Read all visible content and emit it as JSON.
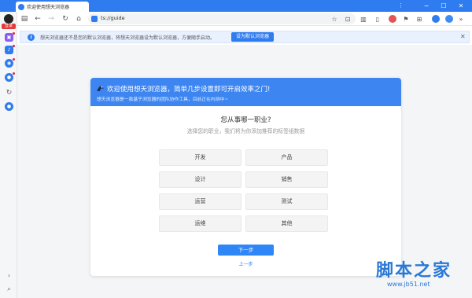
{
  "tab": {
    "title": "欢迎使用想天浏览器"
  },
  "window": {
    "min": "−",
    "max": "☐",
    "close": "✕",
    "menu": "⋮"
  },
  "sidebar": {
    "login_label": "登录"
  },
  "address_bar": {
    "url": "ts://guide"
  },
  "notice": {
    "info": "i",
    "text": "想天浏览器还不是您的默认浏览器，将想天浏览器设为默认浏览器，方便随手启动。",
    "button": "设为默认浏览器",
    "close": "✕"
  },
  "card": {
    "headline": "欢迎使用想天浏览器，简单几步设置即可开启效率之门!",
    "subline": "想天浏览器是一款基于浏览器的团队协作工具，目前正在内测中~",
    "question": "您从事哪一职业?",
    "hint": "选择您的职业，我们将为你添加推荐的标签组数据",
    "options": [
      "开发",
      "产品",
      "设计",
      "销售",
      "运营",
      "测试",
      "运维",
      "其他"
    ],
    "next": "下一步",
    "prev": "上一步"
  },
  "watermark": {
    "text": "脚本之家",
    "url": "www.jb51.net"
  },
  "colors": {
    "accent": "#2f7bf0",
    "header": "#3d86f1",
    "alert": "#e03b3b"
  }
}
